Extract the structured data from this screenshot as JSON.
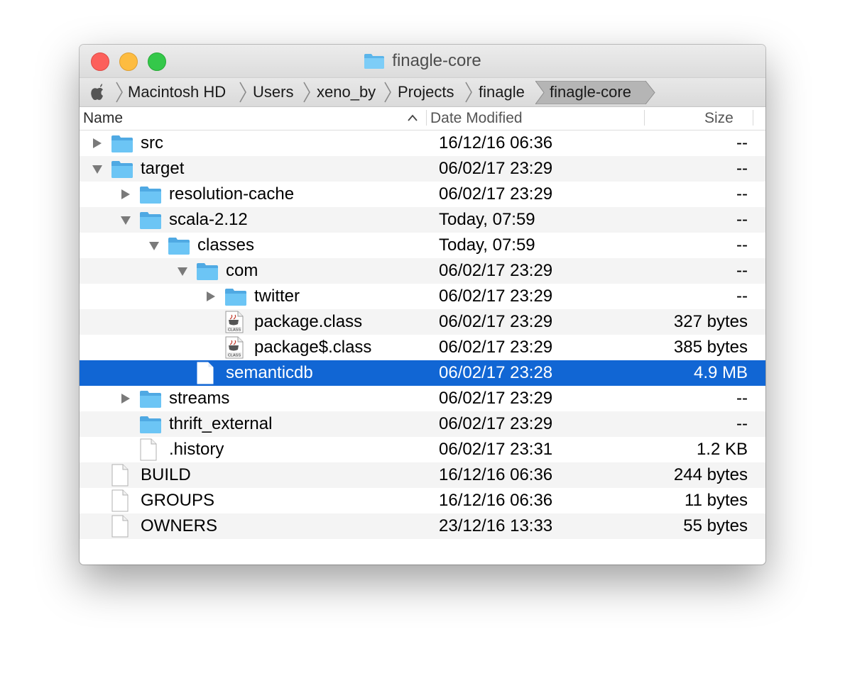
{
  "window": {
    "title": "finagle-core",
    "title_icon": "folder-icon"
  },
  "pathbar": {
    "root_icon": "apple-icon",
    "crumbs": [
      "Macintosh HD",
      "Users",
      "xeno_by",
      "Projects",
      "finagle",
      "finagle-core"
    ]
  },
  "columns": {
    "name": "Name",
    "date": "Date Modified",
    "size": "Size",
    "sort_indicator": "^"
  },
  "rows": [
    {
      "name": "src",
      "date": "16/12/16 06:36",
      "size": "--",
      "kind": "folder",
      "depth": 0,
      "disclosure": "collapsed"
    },
    {
      "name": "target",
      "date": "06/02/17 23:29",
      "size": "--",
      "kind": "folder",
      "depth": 0,
      "disclosure": "expanded"
    },
    {
      "name": "resolution-cache",
      "date": "06/02/17 23:29",
      "size": "--",
      "kind": "folder",
      "depth": 1,
      "disclosure": "collapsed"
    },
    {
      "name": "scala-2.12",
      "date": "Today, 07:59",
      "size": "--",
      "kind": "folder",
      "depth": 1,
      "disclosure": "expanded"
    },
    {
      "name": "classes",
      "date": "Today, 07:59",
      "size": "--",
      "kind": "folder",
      "depth": 2,
      "disclosure": "expanded"
    },
    {
      "name": "com",
      "date": "06/02/17 23:29",
      "size": "--",
      "kind": "folder",
      "depth": 3,
      "disclosure": "expanded"
    },
    {
      "name": "twitter",
      "date": "06/02/17 23:29",
      "size": "--",
      "kind": "folder",
      "depth": 4,
      "disclosure": "collapsed"
    },
    {
      "name": "package.class",
      "date": "06/02/17 23:29",
      "size": "327 bytes",
      "kind": "class",
      "depth": 4,
      "disclosure": "none",
      "icon_label": "CLASS"
    },
    {
      "name": "package$.class",
      "date": "06/02/17 23:29",
      "size": "385 bytes",
      "kind": "class",
      "depth": 4,
      "disclosure": "none",
      "icon_label": "CLASS"
    },
    {
      "name": "semanticdb",
      "date": "06/02/17 23:28",
      "size": "4.9 MB",
      "kind": "file",
      "depth": 3,
      "disclosure": "none",
      "selected": true
    },
    {
      "name": "streams",
      "date": "06/02/17 23:29",
      "size": "--",
      "kind": "folder",
      "depth": 1,
      "disclosure": "collapsed"
    },
    {
      "name": "thrift_external",
      "date": "06/02/17 23:29",
      "size": "--",
      "kind": "folder",
      "depth": 1,
      "disclosure": "none"
    },
    {
      "name": ".history",
      "date": "06/02/17 23:31",
      "size": "1.2 KB",
      "kind": "file",
      "depth": 1,
      "disclosure": "none"
    },
    {
      "name": "BUILD",
      "date": "16/12/16 06:36",
      "size": "244 bytes",
      "kind": "file",
      "depth": 0,
      "disclosure": "none"
    },
    {
      "name": "GROUPS",
      "date": "16/12/16 06:36",
      "size": "11 bytes",
      "kind": "file",
      "depth": 0,
      "disclosure": "none"
    },
    {
      "name": "OWNERS",
      "date": "23/12/16 13:33",
      "size": "55 bytes",
      "kind": "file",
      "depth": 0,
      "disclosure": "none"
    }
  ],
  "colors": {
    "selection": "#1166d4",
    "folder": "#6cc5f5",
    "alt_row": "#f4f4f4"
  }
}
